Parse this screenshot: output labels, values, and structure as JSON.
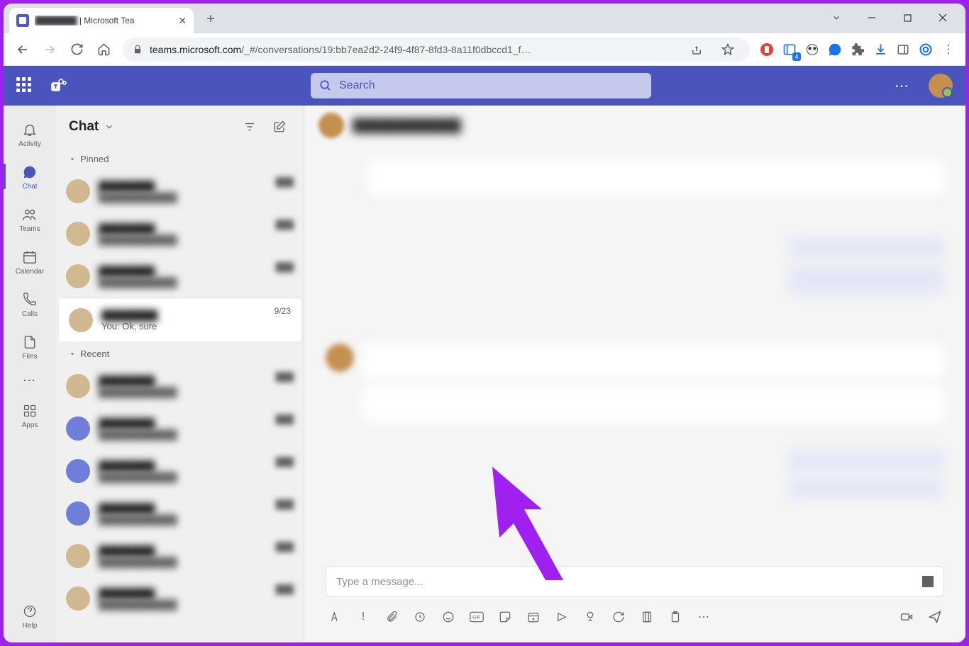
{
  "browser": {
    "tab_title_suffix": " | Microsoft Tea",
    "url_host": "teams.microsoft.com",
    "url_path": "/_#/conversations/19:bb7ea2d2-24f9-4f87-8fd3-8a11f0dbccd1_f…",
    "ext_badge": "4"
  },
  "header": {
    "search_placeholder": "Search"
  },
  "rail": {
    "items": [
      {
        "label": "Activity"
      },
      {
        "label": "Chat"
      },
      {
        "label": "Teams"
      },
      {
        "label": "Calendar"
      },
      {
        "label": "Calls"
      },
      {
        "label": "Files"
      }
    ],
    "apps": "Apps",
    "help": "Help"
  },
  "chatlist": {
    "title": "Chat",
    "pinned_label": "Pinned",
    "recent_label": "Recent",
    "highlighted": {
      "date": "9/23",
      "preview": "You: Ok, sure"
    }
  },
  "compose": {
    "placeholder": "Type a message..."
  }
}
